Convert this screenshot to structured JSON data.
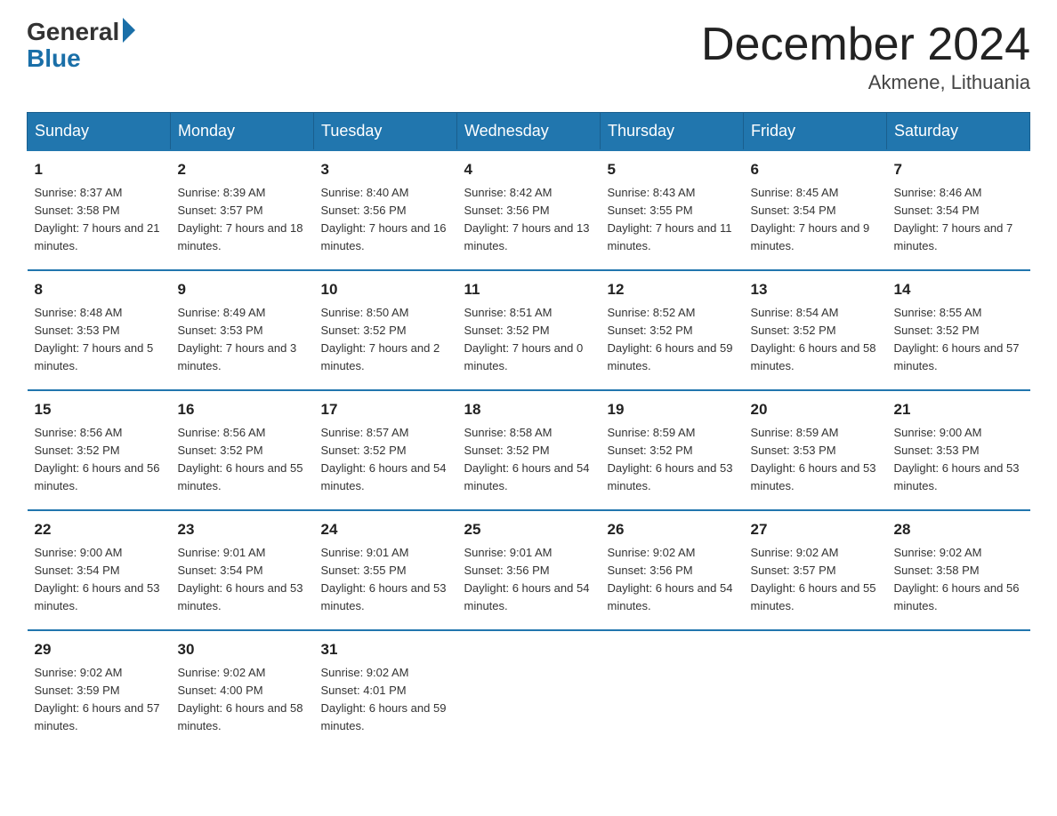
{
  "header": {
    "logo_general": "General",
    "logo_blue": "Blue",
    "month_title": "December 2024",
    "location": "Akmene, Lithuania"
  },
  "days_of_week": [
    "Sunday",
    "Monday",
    "Tuesday",
    "Wednesday",
    "Thursday",
    "Friday",
    "Saturday"
  ],
  "weeks": [
    [
      {
        "day": "1",
        "sunrise": "8:37 AM",
        "sunset": "3:58 PM",
        "daylight": "7 hours and 21 minutes."
      },
      {
        "day": "2",
        "sunrise": "8:39 AM",
        "sunset": "3:57 PM",
        "daylight": "7 hours and 18 minutes."
      },
      {
        "day": "3",
        "sunrise": "8:40 AM",
        "sunset": "3:56 PM",
        "daylight": "7 hours and 16 minutes."
      },
      {
        "day": "4",
        "sunrise": "8:42 AM",
        "sunset": "3:56 PM",
        "daylight": "7 hours and 13 minutes."
      },
      {
        "day": "5",
        "sunrise": "8:43 AM",
        "sunset": "3:55 PM",
        "daylight": "7 hours and 11 minutes."
      },
      {
        "day": "6",
        "sunrise": "8:45 AM",
        "sunset": "3:54 PM",
        "daylight": "7 hours and 9 minutes."
      },
      {
        "day": "7",
        "sunrise": "8:46 AM",
        "sunset": "3:54 PM",
        "daylight": "7 hours and 7 minutes."
      }
    ],
    [
      {
        "day": "8",
        "sunrise": "8:48 AM",
        "sunset": "3:53 PM",
        "daylight": "7 hours and 5 minutes."
      },
      {
        "day": "9",
        "sunrise": "8:49 AM",
        "sunset": "3:53 PM",
        "daylight": "7 hours and 3 minutes."
      },
      {
        "day": "10",
        "sunrise": "8:50 AM",
        "sunset": "3:52 PM",
        "daylight": "7 hours and 2 minutes."
      },
      {
        "day": "11",
        "sunrise": "8:51 AM",
        "sunset": "3:52 PM",
        "daylight": "7 hours and 0 minutes."
      },
      {
        "day": "12",
        "sunrise": "8:52 AM",
        "sunset": "3:52 PM",
        "daylight": "6 hours and 59 minutes."
      },
      {
        "day": "13",
        "sunrise": "8:54 AM",
        "sunset": "3:52 PM",
        "daylight": "6 hours and 58 minutes."
      },
      {
        "day": "14",
        "sunrise": "8:55 AM",
        "sunset": "3:52 PM",
        "daylight": "6 hours and 57 minutes."
      }
    ],
    [
      {
        "day": "15",
        "sunrise": "8:56 AM",
        "sunset": "3:52 PM",
        "daylight": "6 hours and 56 minutes."
      },
      {
        "day": "16",
        "sunrise": "8:56 AM",
        "sunset": "3:52 PM",
        "daylight": "6 hours and 55 minutes."
      },
      {
        "day": "17",
        "sunrise": "8:57 AM",
        "sunset": "3:52 PM",
        "daylight": "6 hours and 54 minutes."
      },
      {
        "day": "18",
        "sunrise": "8:58 AM",
        "sunset": "3:52 PM",
        "daylight": "6 hours and 54 minutes."
      },
      {
        "day": "19",
        "sunrise": "8:59 AM",
        "sunset": "3:52 PM",
        "daylight": "6 hours and 53 minutes."
      },
      {
        "day": "20",
        "sunrise": "8:59 AM",
        "sunset": "3:53 PM",
        "daylight": "6 hours and 53 minutes."
      },
      {
        "day": "21",
        "sunrise": "9:00 AM",
        "sunset": "3:53 PM",
        "daylight": "6 hours and 53 minutes."
      }
    ],
    [
      {
        "day": "22",
        "sunrise": "9:00 AM",
        "sunset": "3:54 PM",
        "daylight": "6 hours and 53 minutes."
      },
      {
        "day": "23",
        "sunrise": "9:01 AM",
        "sunset": "3:54 PM",
        "daylight": "6 hours and 53 minutes."
      },
      {
        "day": "24",
        "sunrise": "9:01 AM",
        "sunset": "3:55 PM",
        "daylight": "6 hours and 53 minutes."
      },
      {
        "day": "25",
        "sunrise": "9:01 AM",
        "sunset": "3:56 PM",
        "daylight": "6 hours and 54 minutes."
      },
      {
        "day": "26",
        "sunrise": "9:02 AM",
        "sunset": "3:56 PM",
        "daylight": "6 hours and 54 minutes."
      },
      {
        "day": "27",
        "sunrise": "9:02 AM",
        "sunset": "3:57 PM",
        "daylight": "6 hours and 55 minutes."
      },
      {
        "day": "28",
        "sunrise": "9:02 AM",
        "sunset": "3:58 PM",
        "daylight": "6 hours and 56 minutes."
      }
    ],
    [
      {
        "day": "29",
        "sunrise": "9:02 AM",
        "sunset": "3:59 PM",
        "daylight": "6 hours and 57 minutes."
      },
      {
        "day": "30",
        "sunrise": "9:02 AM",
        "sunset": "4:00 PM",
        "daylight": "6 hours and 58 minutes."
      },
      {
        "day": "31",
        "sunrise": "9:02 AM",
        "sunset": "4:01 PM",
        "daylight": "6 hours and 59 minutes."
      },
      {
        "day": "",
        "sunrise": "",
        "sunset": "",
        "daylight": ""
      },
      {
        "day": "",
        "sunrise": "",
        "sunset": "",
        "daylight": ""
      },
      {
        "day": "",
        "sunrise": "",
        "sunset": "",
        "daylight": ""
      },
      {
        "day": "",
        "sunrise": "",
        "sunset": "",
        "daylight": ""
      }
    ]
  ]
}
